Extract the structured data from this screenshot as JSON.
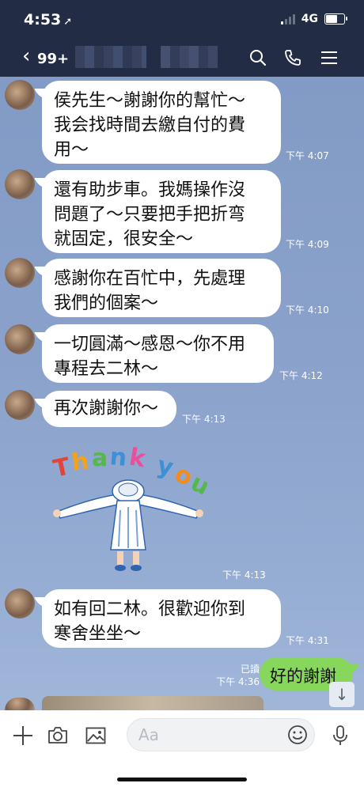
{
  "status_bar": {
    "time": "4:53",
    "network": "4G"
  },
  "header": {
    "back_count": "99+"
  },
  "messages": [
    {
      "text": "侯先生～謝謝你的幫忙～\n我会找時間去繳自付的費\n用～",
      "time": "下午 4:07"
    },
    {
      "text": "還有助步車。我媽操作沒\n問題了～只要把手把折弯\n就固定，很安全～",
      "time": "下午 4:09"
    },
    {
      "text": "感謝你在百忙中，先處理\n我們的個案～",
      "time": "下午 4:10"
    },
    {
      "text": "一切圓滿～感恩～你不用\n專程去二林～",
      "time": "下午 4:12"
    },
    {
      "text": "再次謝謝你～",
      "time": "下午 4:13"
    }
  ],
  "sticker": {
    "letters": [
      "T",
      "h",
      "a",
      "n",
      "k",
      " ",
      "y",
      "o",
      "u"
    ],
    "time": "下午 4:13",
    "colors": [
      "#e0453a",
      "#f2a31b",
      "#56b848",
      "#3d8fd6",
      "#e94f9a",
      "#3d8fd6",
      "#f28c1b",
      "#56b848"
    ]
  },
  "message_after": {
    "text": "如有回二林。很歡迎你到\n寒舍坐坐～",
    "time": "下午 4:31"
  },
  "my_message": {
    "text": "好的謝謝",
    "read": "已讀",
    "time": "下午 4:36"
  },
  "input": {
    "placeholder": "Aa"
  },
  "colors": {
    "header": "#232c45",
    "my_bubble": "#86d75b"
  }
}
